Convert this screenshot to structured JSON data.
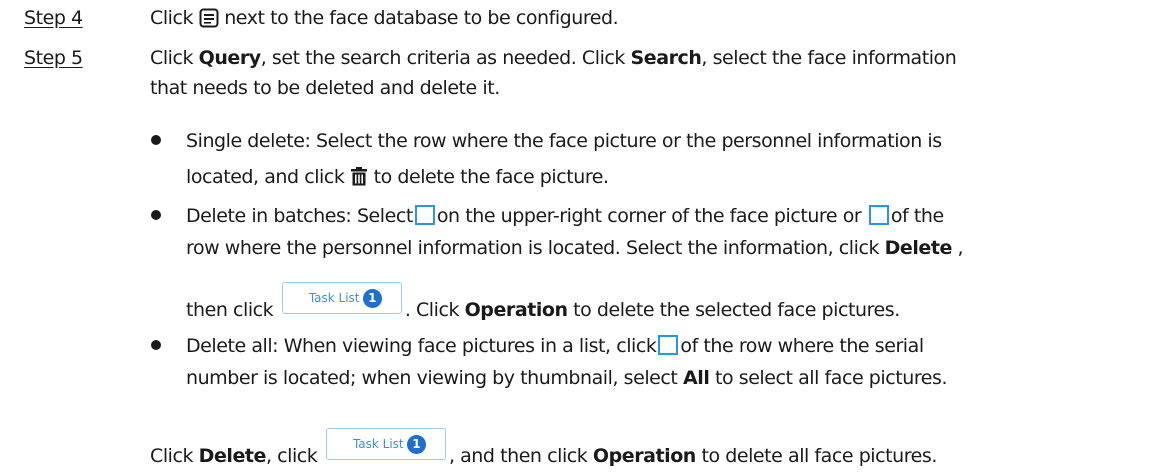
{
  "step4": {
    "label": "Step 4",
    "text_before": "Click",
    "text_after": "next to the face database to be configured."
  },
  "step5": {
    "label": "Step 5",
    "l1_a": "Click",
    "l1_b": "Query",
    "l1_c": ", set the search criteria as needed. Click",
    "l1_d": "Search",
    "l1_e": ", select the face information",
    "l2": "that needs to be deleted and delete it."
  },
  "bullet1": {
    "l1": "Single delete: Select the row where the face picture or the personnel information is",
    "l2_a": "located, and click",
    "l2_b": "to delete the face picture."
  },
  "bullet2": {
    "l1_a": "Delete in batches: Select",
    "l1_b": "on the upper-right corner of the face picture or",
    "l1_c": "of the",
    "l2_a": "row where the personnel information is located. Select the information, click",
    "l2_b": "Delete",
    "l2_c": ",",
    "l3_a": "then click",
    "l3_b": ". Click",
    "l3_c": "Operation",
    "l3_d": "to delete the selected face pictures."
  },
  "bullet3": {
    "l1_a": "Delete all: When viewing face pictures in a list, click",
    "l1_b": "of the row where the serial",
    "l2_a": "number is located; when viewing by thumbnail, select",
    "l2_b": "All",
    "l2_c": "to select all face pictures.",
    "l3_a": "Click",
    "l3_b": "Delete",
    "l3_c": ", click",
    "l3_d": ", and then click",
    "l3_e": "Operation",
    "l3_f": "to delete all face pictures."
  },
  "task_list_button": {
    "label": "Task List",
    "badge": "1"
  },
  "icons": {
    "details": "list-details-icon",
    "delete": "trash-icon",
    "checkbox": "checkbox-icon"
  },
  "colors": {
    "accent": "#2b96e0",
    "badge": "#1f6fd1"
  }
}
